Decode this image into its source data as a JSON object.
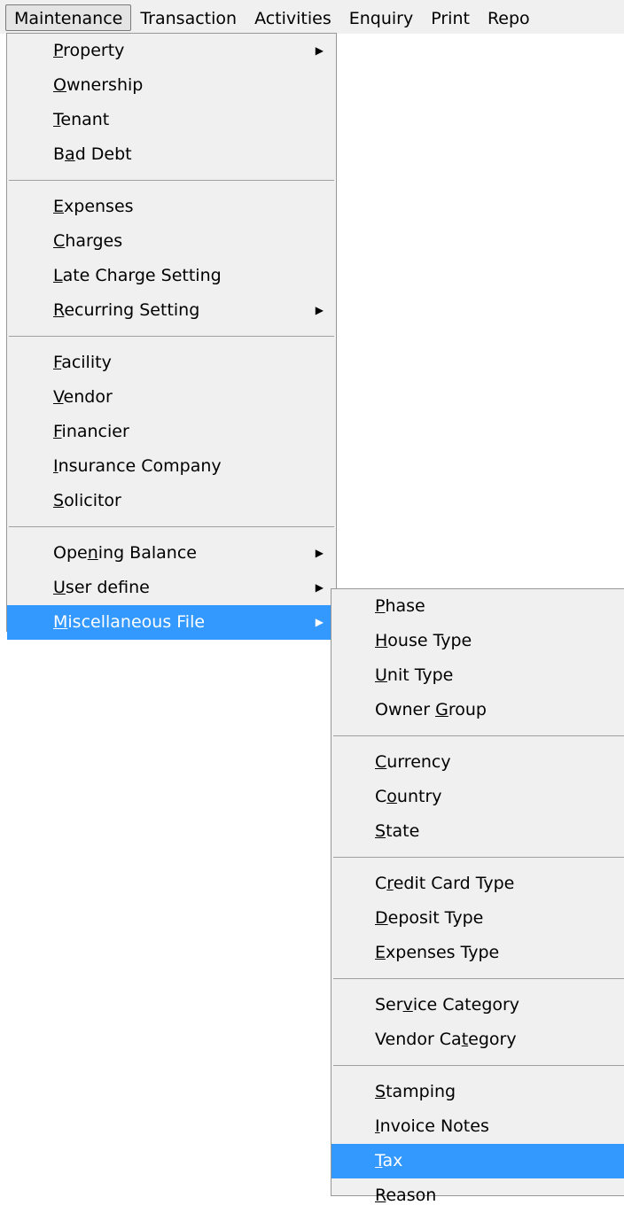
{
  "menubar": {
    "items": [
      "Maintenance",
      "Transaction",
      "Activities",
      "Enquiry",
      "Print",
      "Repo"
    ]
  },
  "main_menu": {
    "items": [
      {
        "pre": "",
        "key": "P",
        "post": "roperty",
        "submenu": true
      },
      {
        "pre": "",
        "key": "O",
        "post": "wnership",
        "submenu": false
      },
      {
        "pre": "",
        "key": "T",
        "post": "enant",
        "submenu": false
      },
      {
        "pre": "B",
        "key": "a",
        "post": "d Debt",
        "submenu": false
      },
      {
        "pre": "",
        "key": "E",
        "post": "xpenses",
        "submenu": false
      },
      {
        "pre": "",
        "key": "C",
        "post": "harges",
        "submenu": false
      },
      {
        "pre": "",
        "key": "L",
        "post": "ate Charge Setting",
        "submenu": false
      },
      {
        "pre": "",
        "key": "R",
        "post": "ecurring Setting",
        "submenu": true
      },
      {
        "pre": "",
        "key": "F",
        "post": "acility",
        "submenu": false
      },
      {
        "pre": "",
        "key": "V",
        "post": "endor",
        "submenu": false
      },
      {
        "pre": "",
        "key": "F",
        "post": "inancier",
        "submenu": false
      },
      {
        "pre": "",
        "key": "I",
        "post": "nsurance Company",
        "submenu": false
      },
      {
        "pre": "",
        "key": "S",
        "post": "olicitor",
        "submenu": false
      },
      {
        "pre": "Ope",
        "key": "n",
        "post": "ing Balance",
        "submenu": true
      },
      {
        "pre": "",
        "key": "U",
        "post": "ser define",
        "submenu": true
      },
      {
        "pre": "",
        "key": "M",
        "post": "iscellaneous File",
        "submenu": true
      }
    ]
  },
  "sub_menu": {
    "items": [
      {
        "pre": "",
        "key": "P",
        "post": "hase"
      },
      {
        "pre": "",
        "key": "H",
        "post": "ouse Type"
      },
      {
        "pre": "",
        "key": "U",
        "post": "nit Type"
      },
      {
        "pre": "Owner ",
        "key": "G",
        "post": "roup"
      },
      {
        "pre": "",
        "key": "C",
        "post": "urrency"
      },
      {
        "pre": "C",
        "key": "o",
        "post": "untry"
      },
      {
        "pre": "",
        "key": "S",
        "post": "tate"
      },
      {
        "pre": "C",
        "key": "r",
        "post": "edit Card Type"
      },
      {
        "pre": "",
        "key": "D",
        "post": "eposit Type"
      },
      {
        "pre": "",
        "key": "E",
        "post": "xpenses Type"
      },
      {
        "pre": "Ser",
        "key": "v",
        "post": "ice Category"
      },
      {
        "pre": "Vendor Ca",
        "key": "t",
        "post": "egory"
      },
      {
        "pre": "",
        "key": "S",
        "post": "tamping"
      },
      {
        "pre": "",
        "key": "I",
        "post": "nvoice Notes"
      },
      {
        "pre": "",
        "key": "T",
        "post": "ax"
      },
      {
        "pre": "",
        "key": "R",
        "post": "eason"
      }
    ]
  },
  "icons": {
    "submenu_arrow": "triangle-right-icon"
  },
  "colors": {
    "highlight": "#3399ff",
    "menu_bg": "#f0f0f0"
  }
}
